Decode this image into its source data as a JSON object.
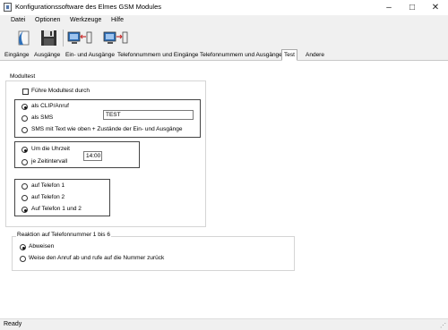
{
  "window": {
    "title": "Konfigurationssoftware des Elmes GSM Modules"
  },
  "menu": [
    "Datei",
    "Optionen",
    "Werkzeuge",
    "Hilfe"
  ],
  "toolbar": {
    "icons": [
      "open-file-icon",
      "save-icon",
      "upload-to-module-icon",
      "download-from-module-icon"
    ]
  },
  "tabs": [
    "Eingänge",
    "Ausgänge",
    "Ein- und Ausgänge",
    "Telefonnummern und Eingänge",
    "Telefonnummern und Ausgänge",
    "Test",
    "Andere"
  ],
  "active_tab": "Test",
  "modultest": {
    "legend": "Modultest",
    "checkbox_label": "Führe Modultest durch",
    "mode_options": [
      "als CLIP/Anruf",
      "als SMS",
      "SMS mit Text wie oben + Zustände der Ein- und Ausgänge"
    ],
    "mode_selected": 0,
    "sms_text": "TEST",
    "time_options": [
      "Um die Uhrzeit",
      "je Zeitintervall"
    ],
    "time_selected": 0,
    "time_value": "14:00",
    "phone_options": [
      "auf Telefon 1",
      "auf Telefon 2",
      "Auf Telefon 1 und 2"
    ],
    "phone_selected": 2
  },
  "reaktion": {
    "legend": "Reaktion auf Telefonnummer 1 bis 6",
    "options": [
      "Abweisen",
      "Weise den Anruf ab und rufe auf die Nummer zurück"
    ],
    "selected": 0
  },
  "status": "Ready"
}
